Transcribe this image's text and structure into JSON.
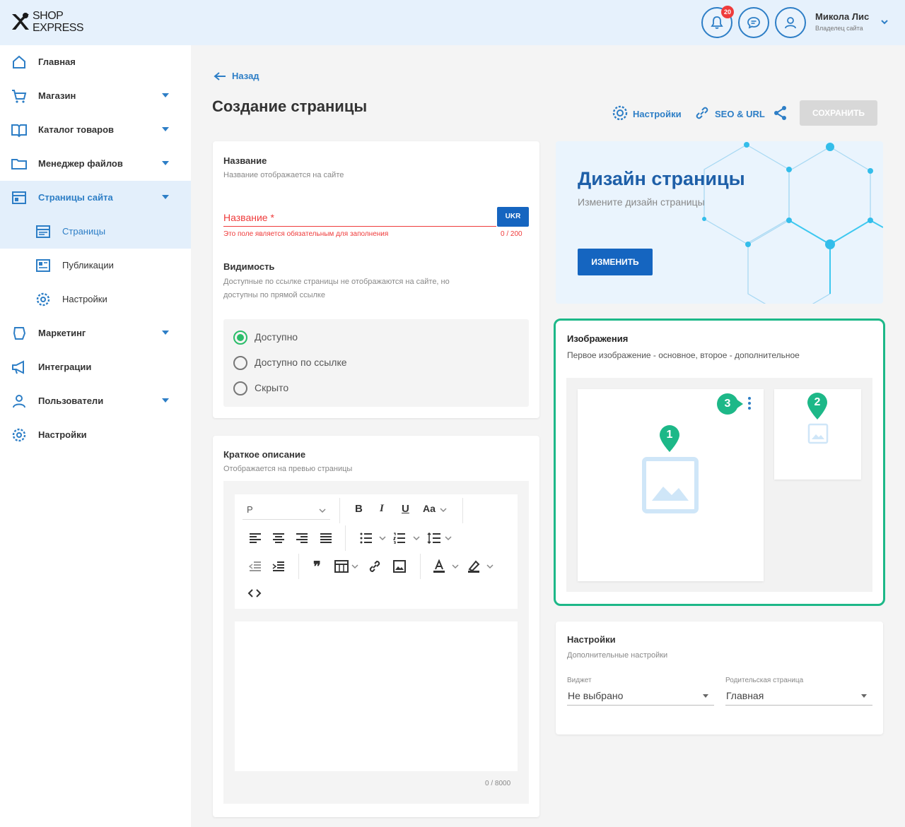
{
  "header": {
    "logo_line1": "SHOP",
    "logo_line2": "EXPRESS",
    "notifications_count": "20",
    "user_name": "Микола Лис",
    "user_role": "Владелец сайта"
  },
  "sidebar": {
    "items": [
      {
        "label": "Главная",
        "icon": "home-icon"
      },
      {
        "label": "Магазин",
        "icon": "cart-icon"
      },
      {
        "label": "Каталог товаров",
        "icon": "book-icon"
      },
      {
        "label": "Менеджер файлов",
        "icon": "folder-icon"
      },
      {
        "label": "Страницы сайта",
        "icon": "pages-icon"
      },
      {
        "label": "Страницы",
        "icon": "page-icon"
      },
      {
        "label": "Публикации",
        "icon": "news-icon"
      },
      {
        "label": "Настройки",
        "icon": "gear-icon"
      },
      {
        "label": "Маркетинг",
        "icon": "marketing-icon"
      },
      {
        "label": "Интеграции",
        "icon": "megaphone-icon"
      },
      {
        "label": "Пользователи",
        "icon": "users-icon"
      },
      {
        "label": "Настройки",
        "icon": "gear-icon"
      }
    ]
  },
  "main": {
    "back_label": "Назад",
    "title": "Создание страницы",
    "toolbar": {
      "settings_label": "Настройки",
      "seo_label": "SEO & URL",
      "save_label": "СОХРАНИТЬ"
    }
  },
  "name_card": {
    "title": "Название",
    "subtitle": "Название отображается на сайте",
    "input_label": "Название *",
    "lang_button": "UKR",
    "error": "Это поле является обязательным для заполнения",
    "counter": "0 / 200",
    "visibility_title": "Видимость",
    "visibility_desc_line1": "Доступные по ссылке страницы не отображаются на сайте, но",
    "visibility_desc_line2": "доступны по прямой ссылке",
    "radios": [
      {
        "label": "Доступно",
        "checked": true
      },
      {
        "label": "Доступно по ссылке",
        "checked": false
      },
      {
        "label": "Скрыто",
        "checked": false
      }
    ]
  },
  "desc_card": {
    "title": "Краткое описание",
    "subtitle": "Отображается на превью страницы",
    "format_select": "P",
    "counter": "0 / 8000"
  },
  "design_banner": {
    "title": "Дизайн страницы",
    "subtitle": "Измените дизайн страницы",
    "button": "ИЗМЕНИТЬ"
  },
  "images_card": {
    "title": "Изображения",
    "subtitle": "Первое изображение - основное, второе - дополнительное",
    "markers": [
      "1",
      "2",
      "3"
    ]
  },
  "settings_card": {
    "title": "Настройки",
    "subtitle": "Дополнительные настройки",
    "widget_label": "Виджет",
    "widget_value": "Не выбрано",
    "parent_label": "Родительская страница",
    "parent_value": "Главная"
  },
  "colors": {
    "accent": "#2d7ec6",
    "primary_button": "#1565c0",
    "error": "#ef3b3b",
    "highlight": "#1db888"
  }
}
